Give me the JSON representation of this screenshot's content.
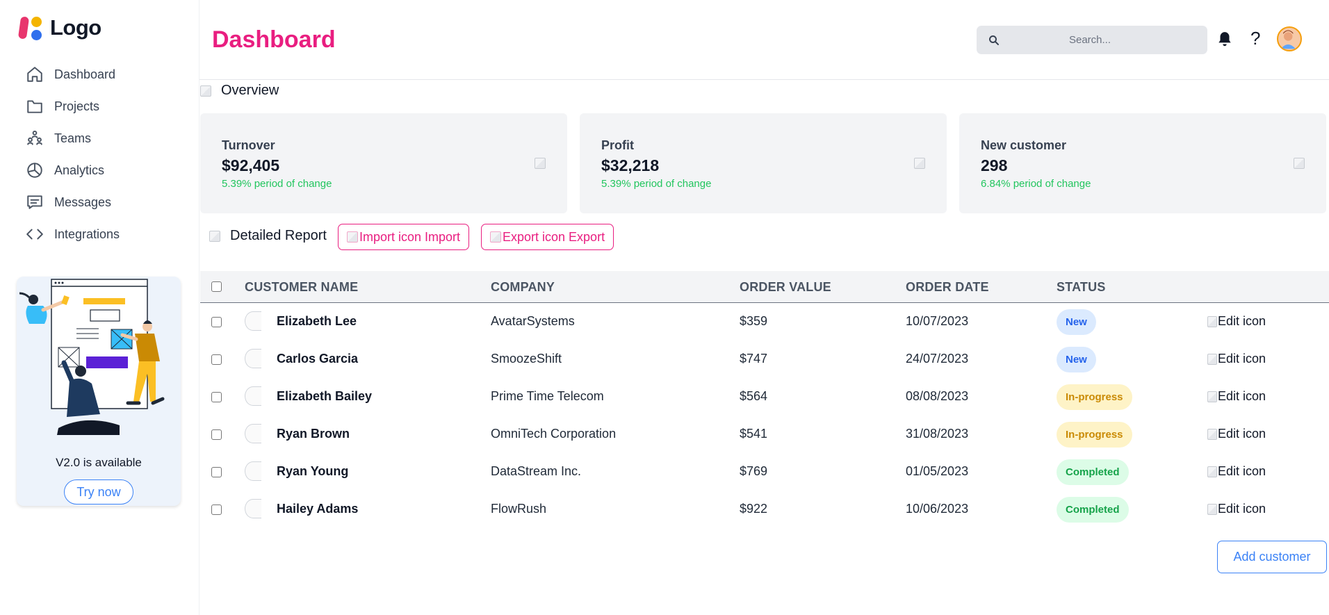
{
  "brand": {
    "logo_text": "Logo",
    "colors": {
      "accent": "#e91e80",
      "primary": "#3b82f6",
      "success": "#22c55e"
    }
  },
  "sidebar": {
    "items": [
      {
        "label": "Dashboard",
        "icon": "home-icon"
      },
      {
        "label": "Projects",
        "icon": "folder-icon"
      },
      {
        "label": "Teams",
        "icon": "users-icon"
      },
      {
        "label": "Analytics",
        "icon": "pie-chart-icon"
      },
      {
        "label": "Messages",
        "icon": "message-icon"
      },
      {
        "label": "Integrations",
        "icon": "code-icon"
      }
    ],
    "promo": {
      "text": "V2.0 is available",
      "button": "Try now"
    }
  },
  "header": {
    "title": "Dashboard",
    "search_placeholder": "Search...",
    "help_label": "?"
  },
  "overview": {
    "title": "Overview",
    "cards": [
      {
        "label": "Turnover",
        "value": "$92,405",
        "change": "5.39% period of change"
      },
      {
        "label": "Profit",
        "value": "$32,218",
        "change": "5.39% period of change"
      },
      {
        "label": "New customer",
        "value": "298",
        "change": "6.84% period of change"
      }
    ]
  },
  "report": {
    "title": "Detailed Report",
    "import_label": "Import icon Import",
    "export_label": "Export icon Export",
    "columns": [
      "CUSTOMER NAME",
      "COMPANY",
      "ORDER VALUE",
      "ORDER DATE",
      "STATUS"
    ],
    "edit_label": "Edit icon",
    "rows": [
      {
        "name": "Elizabeth Lee",
        "company": "AvatarSystems",
        "value": "$359",
        "date": "10/07/2023",
        "status": "New"
      },
      {
        "name": "Carlos Garcia",
        "company": "SmoozeShift",
        "value": "$747",
        "date": "24/07/2023",
        "status": "New"
      },
      {
        "name": "Elizabeth Bailey",
        "company": "Prime Time Telecom",
        "value": "$564",
        "date": "08/08/2023",
        "status": "In-progress"
      },
      {
        "name": "Ryan Brown",
        "company": "OmniTech Corporation",
        "value": "$541",
        "date": "31/08/2023",
        "status": "In-progress"
      },
      {
        "name": "Ryan Young",
        "company": "DataStream Inc.",
        "value": "$769",
        "date": "01/05/2023",
        "status": "Completed"
      },
      {
        "name": "Hailey Adams",
        "company": "FlowRush",
        "value": "$922",
        "date": "10/06/2023",
        "status": "Completed"
      }
    ],
    "status_colors": {
      "New": {
        "bg": "#dbeafe",
        "fg": "#2563eb"
      },
      "In-progress": {
        "bg": "#fef3c7",
        "fg": "#ca8a04"
      },
      "Completed": {
        "bg": "#dcfce7",
        "fg": "#16a34a"
      }
    },
    "add_button": "Add customer"
  }
}
